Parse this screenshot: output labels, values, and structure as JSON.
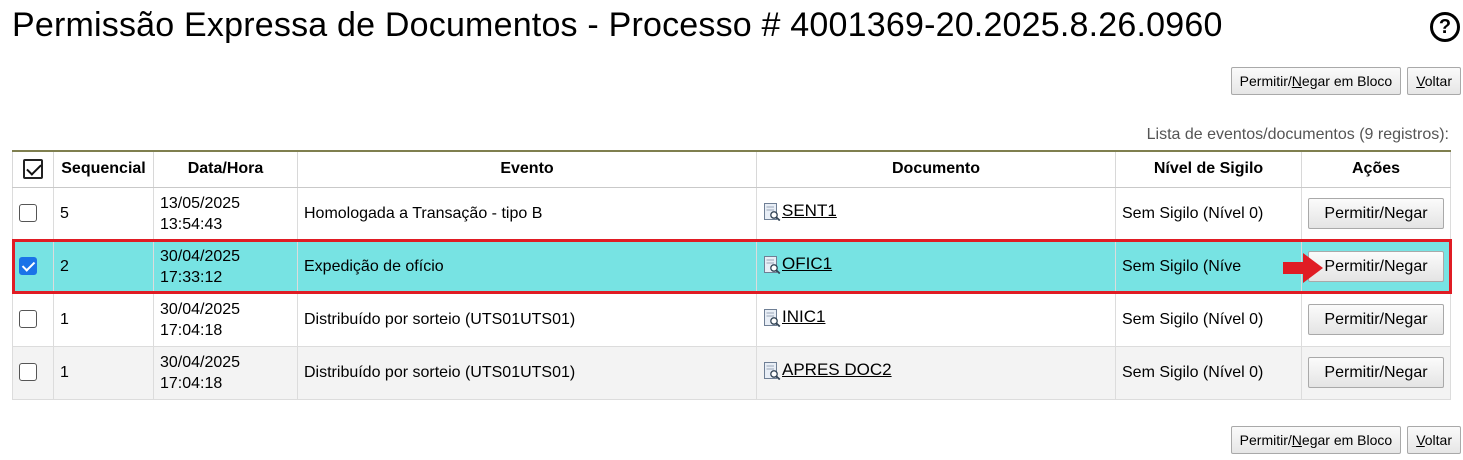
{
  "title": "Permissão Expressa de Documentos - Processo # 4001369-20.2025.8.26.0960",
  "help_icon_label": "?",
  "toolbar": {
    "bulk_pre": "Permitir/",
    "bulk_key": "N",
    "bulk_post": "egar em Bloco",
    "back_key": "V",
    "back_post": "oltar"
  },
  "caption": "Lista de eventos/documentos (9 registros):",
  "table": {
    "headers": [
      "Sequencial",
      "Data/Hora",
      "Evento",
      "Documento",
      "Nível de Sigilo",
      "Ações"
    ],
    "rows": [
      {
        "checked": false,
        "seq": "5",
        "date": "13/05/2025",
        "time": "13:54:43",
        "event": "Homologada a Transação - tipo B",
        "doc": "SENT1",
        "sigilo": "Sem Sigilo (Nível 0)",
        "action": "Permitir/Negar"
      },
      {
        "checked": true,
        "seq": "2",
        "date": "30/04/2025",
        "time": "17:33:12",
        "event": "Expedição de ofício",
        "doc": "OFIC1",
        "sigilo": "Sem Sigilo (Níve",
        "action": "Permitir/Negar"
      },
      {
        "checked": false,
        "seq": "1",
        "date": "30/04/2025",
        "time": "17:04:18",
        "event": "Distribuído por sorteio (UTS01UTS01)",
        "doc": "INIC1",
        "sigilo": "Sem Sigilo (Nível 0)",
        "action": "Permitir/Negar"
      },
      {
        "checked": false,
        "seq": "1",
        "date": "30/04/2025",
        "time": "17:04:18",
        "event": "Distribuído por sorteio (UTS01UTS01)",
        "doc": "APRES DOC2",
        "sigilo": "Sem Sigilo (Nível 0)",
        "action": "Permitir/Negar"
      }
    ]
  },
  "colors": {
    "selected_row": "#77e3e3",
    "highlight_border": "#e01c24",
    "arrow": "#e01c24"
  },
  "icons": {
    "document": "document-magnifier-icon",
    "annotation": "red-arrow-icon",
    "help": "help-circle-icon"
  }
}
